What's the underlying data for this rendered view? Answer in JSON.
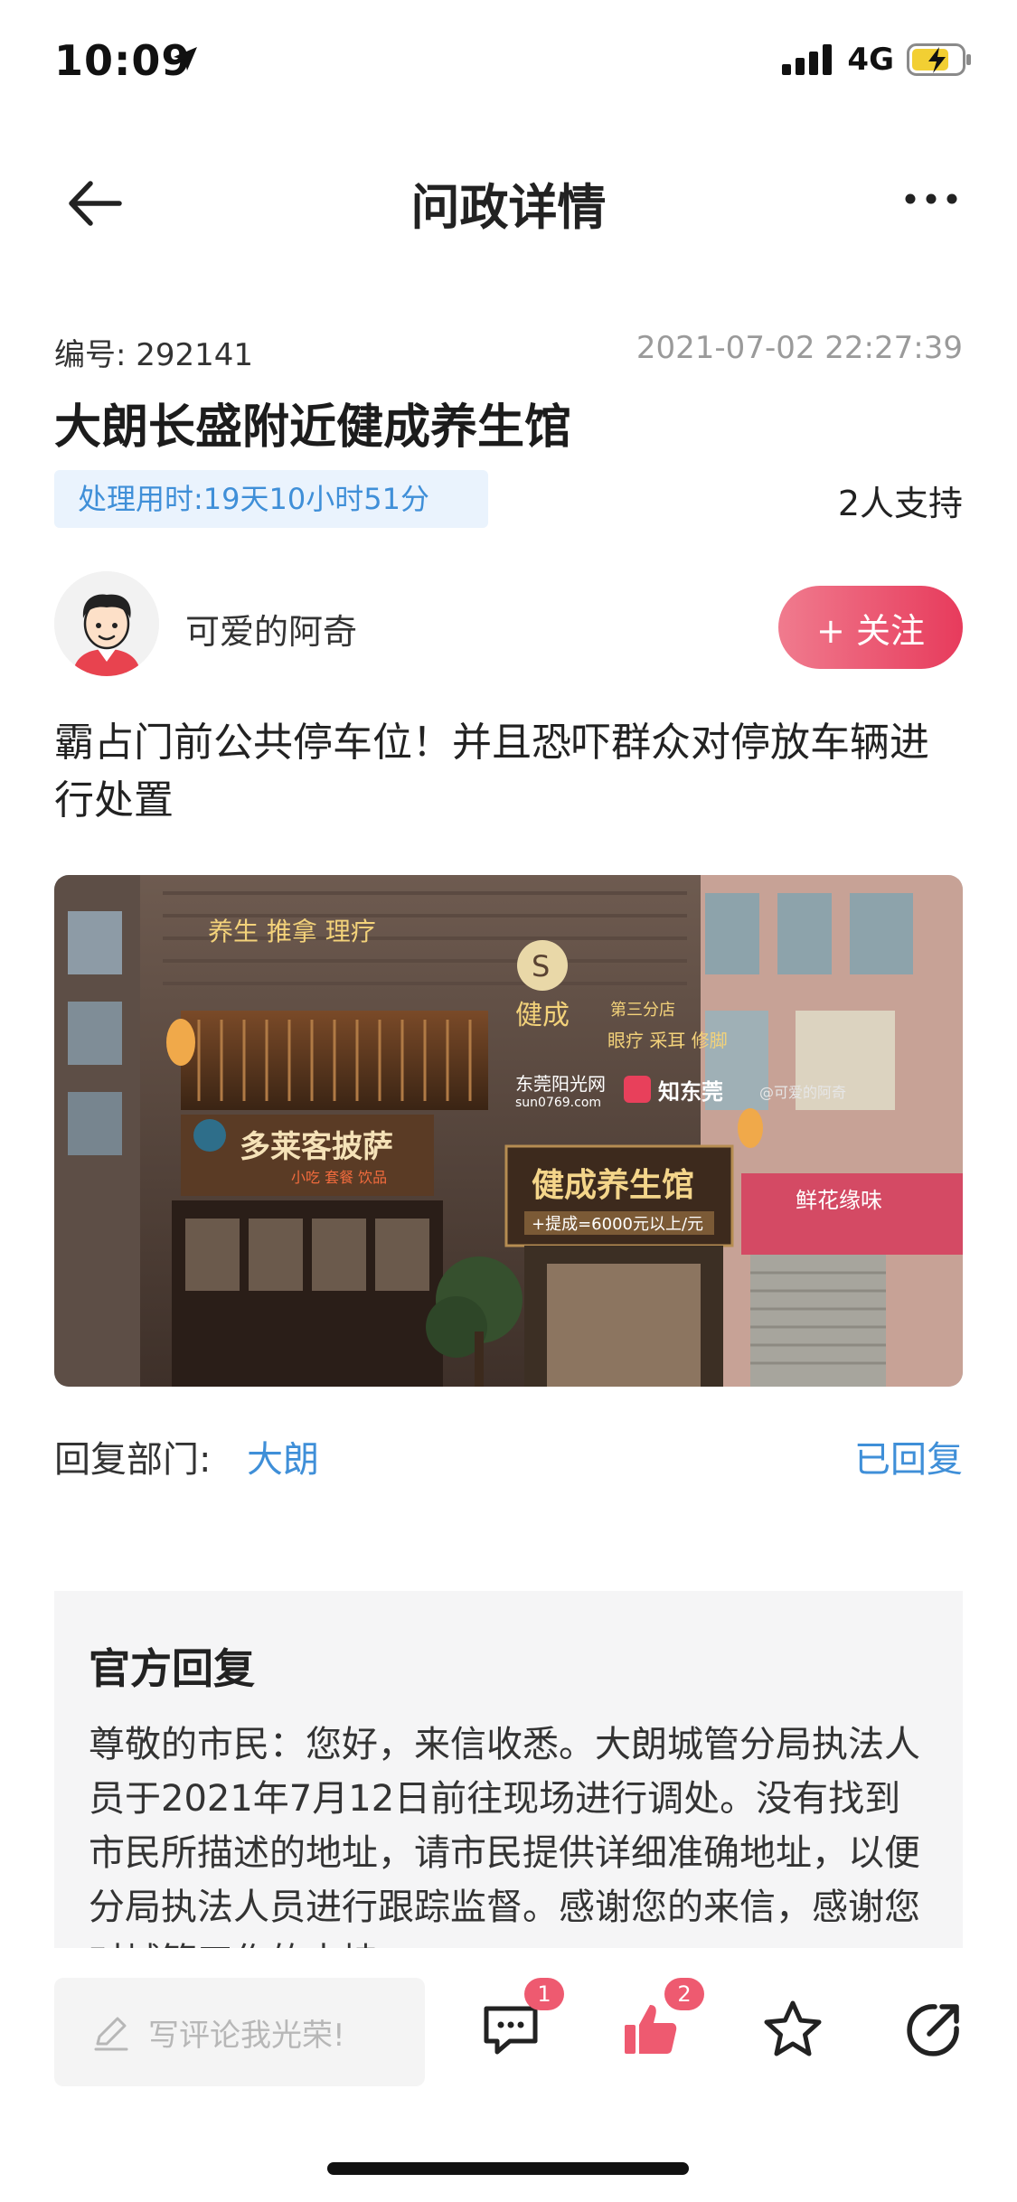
{
  "status_bar": {
    "time": "10:09",
    "network": "4G"
  },
  "nav": {
    "title": "问政详情"
  },
  "post": {
    "number_label": "编号: 292141",
    "datetime": "2021-07-02 22:27:39",
    "title": "大朗长盛附近健成养生馆",
    "processing_time": "处理用时:19天10小时51分",
    "support_count": "2人支持",
    "author": "可爱的阿奇",
    "follow_label": "+ 关注",
    "content": "霸占门前公共停车位！并且恐吓群众对停放车辆进行处置"
  },
  "photo": {
    "sign_main": "健成养生馆",
    "sign_promo": "+提成=6000元以上/元",
    "sign_left": "多莱客披萨",
    "sign_left_sub": "小吃  套餐  饮品",
    "banner_top": "养生    推拿    理疗",
    "store_name": "健成",
    "store_branch": "第三分店",
    "services": "眼疗  采耳  修脚",
    "watermark_site": "东莞阳光网",
    "watermark_url": "sun0769.com",
    "watermark_brand": "知东莞",
    "watermark_author": "@可爱的阿奇",
    "right_shop": "鲜花缘味"
  },
  "reply_meta": {
    "dept_label": "回复部门:",
    "dept": "大朗",
    "status": "已回复"
  },
  "official_reply": {
    "title": "官方回复",
    "text": "尊敬的市民：您好，来信收悉。大朗城管分局执法人员于2021年7月12日前往现场进行调处。没有找到市民所描述的地址，请市民提供详细准确地址，以便分局执法人员进行跟踪监督。感谢您的来信，感谢您对城管工作的支持。"
  },
  "bottom_bar": {
    "comment_placeholder": "写评论我光荣!",
    "comment_count": "1",
    "like_count": "2"
  },
  "colors": {
    "accent_blue": "#3f8fd8",
    "follow_red": "#e73b5c",
    "badge_red": "#ee5a70"
  }
}
